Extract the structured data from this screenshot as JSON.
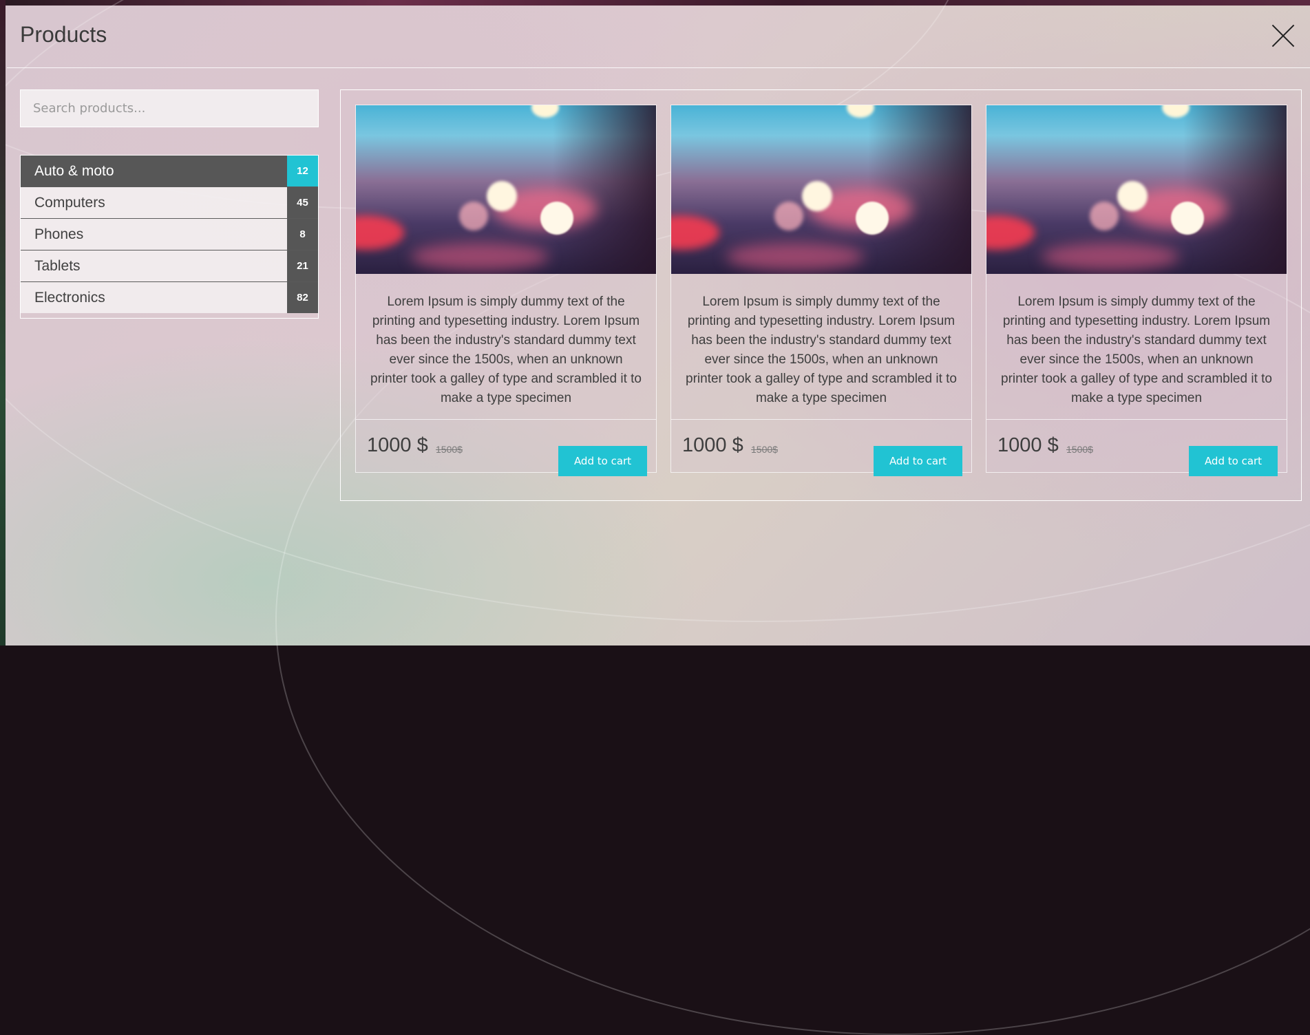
{
  "modal": {
    "title": "Products"
  },
  "search": {
    "placeholder": "Search products..."
  },
  "categories": [
    {
      "label": "Auto & moto",
      "count": "12",
      "active": true
    },
    {
      "label": "Computers",
      "count": "45",
      "active": false
    },
    {
      "label": "Phones",
      "count": "8",
      "active": false
    },
    {
      "label": "Tablets",
      "count": "21",
      "active": false
    },
    {
      "label": "Electronics",
      "count": "82",
      "active": false
    }
  ],
  "products": [
    {
      "description": "Lorem Ipsum is simply dummy text of the printing and typesetting industry. Lorem Ipsum has been the industry's standard dummy text ever since the 1500s, when an unknown printer took a galley of type and scrambled it to make a type specimen",
      "price": "1000 $",
      "old_price": "1500$",
      "button_label": "Add to cart"
    },
    {
      "description": "Lorem Ipsum is simply dummy text of the printing and typesetting industry. Lorem Ipsum has been the industry's standard dummy text ever since the 1500s, when an unknown printer took a galley of type and scrambled it to make a type specimen",
      "price": "1000 $",
      "old_price": "1500$",
      "button_label": "Add to cart"
    },
    {
      "description": "Lorem Ipsum is simply dummy text of the printing and typesetting industry. Lorem Ipsum has been the industry's standard dummy text ever since the 1500s, when an unknown printer took a galley of type and scrambled it to make a type specimen",
      "price": "1000 $",
      "old_price": "1500$",
      "button_label": "Add to cart"
    }
  ],
  "colors": {
    "accent": "#21c3d3",
    "active_bg": "#575757",
    "count_bg": "#565656"
  },
  "icons": {
    "close": "close-icon"
  }
}
